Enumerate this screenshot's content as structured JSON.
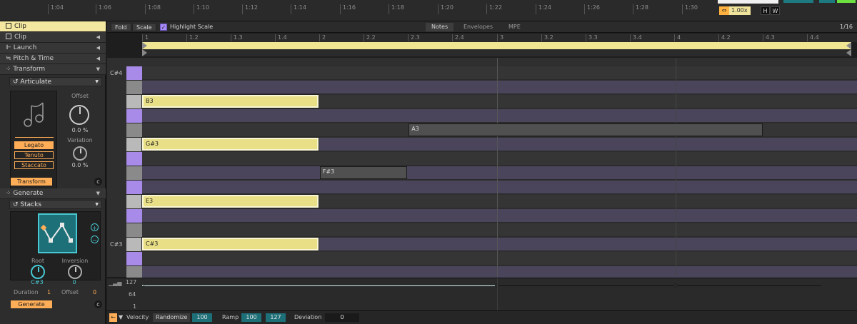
{
  "top_ruler": {
    "ticks": [
      "1:04",
      "1:06",
      "1:08",
      "1:10",
      "1:12",
      "1:14",
      "1:16",
      "1:18",
      "1:20",
      "1:22",
      "1:24",
      "1:26",
      "1:28",
      "1:30"
    ]
  },
  "transport": {
    "speed": "1.00x",
    "h_label": "H",
    "w_label": "W"
  },
  "left_panel": {
    "clip_header": "Clip",
    "sections": {
      "clip": "Clip",
      "launch": "Launch",
      "pitch_time": "Pitch & Time",
      "transform": "Transform",
      "generate": "Generate"
    },
    "articulate": {
      "device_name": "Articulate",
      "offset_label": "Offset",
      "offset_value": "0.0 %",
      "variation_label": "Variation",
      "variation_value": "0.0 %",
      "modes": [
        "Legato",
        "Tenuto",
        "Staccato"
      ],
      "active_mode": "Legato",
      "transform_button": "Transform"
    },
    "stacks": {
      "device_name": "Stacks",
      "root_label": "Root",
      "root_value": "C#3",
      "inversion_label": "Inversion",
      "inversion_value": "0",
      "duration_label": "Duration",
      "duration_value": "1",
      "offset_label": "Offset",
      "offset_value": "0",
      "generate_button": "Generate"
    }
  },
  "toolbar": {
    "fold_label": "Fold",
    "scale_label": "Scale",
    "highlight_scale_label": "Highlight Scale",
    "highlight_scale_checked": true,
    "tabs": [
      "Notes",
      "Envelopes",
      "MPE"
    ],
    "active_tab": "Notes",
    "grid": "1/16"
  },
  "beat_ruler": {
    "ticks": [
      "1",
      "1.2",
      "1.3",
      "1.4",
      "2",
      "2.2",
      "2.3",
      "2.4",
      "3",
      "3.2",
      "3.3",
      "3.4",
      "4",
      "4.2",
      "4.3",
      "4.4"
    ]
  },
  "piano_roll": {
    "key_labels": [
      {
        "label": "C#4"
      },
      {
        "label": "C#3"
      }
    ],
    "notes": [
      {
        "name": "B3",
        "selected": true,
        "start_beat": 1.0,
        "duration_beats": 2.0
      },
      {
        "name": "A3",
        "selected": false,
        "start_beat": 4.0,
        "duration_beats": 4.0
      },
      {
        "name": "G#3",
        "selected": true,
        "start_beat": 1.0,
        "duration_beats": 2.0
      },
      {
        "name": "F#3",
        "selected": false,
        "start_beat": 3.0,
        "duration_beats": 1.0
      },
      {
        "name": "E3",
        "selected": true,
        "start_beat": 1.0,
        "duration_beats": 2.0
      },
      {
        "name": "C#3",
        "selected": true,
        "start_beat": 1.0,
        "duration_beats": 2.0
      }
    ]
  },
  "velocity_lane": {
    "max_label": "127",
    "mid_label": "64",
    "min_label": "1"
  },
  "bottom_bar": {
    "velocity_label": "Velocity",
    "randomize_label": "Randomize",
    "randomize_value": "100",
    "ramp_label": "Ramp",
    "ramp_start": "100",
    "ramp_end": "127",
    "deviation_label": "Deviation",
    "deviation_value": "0"
  }
}
